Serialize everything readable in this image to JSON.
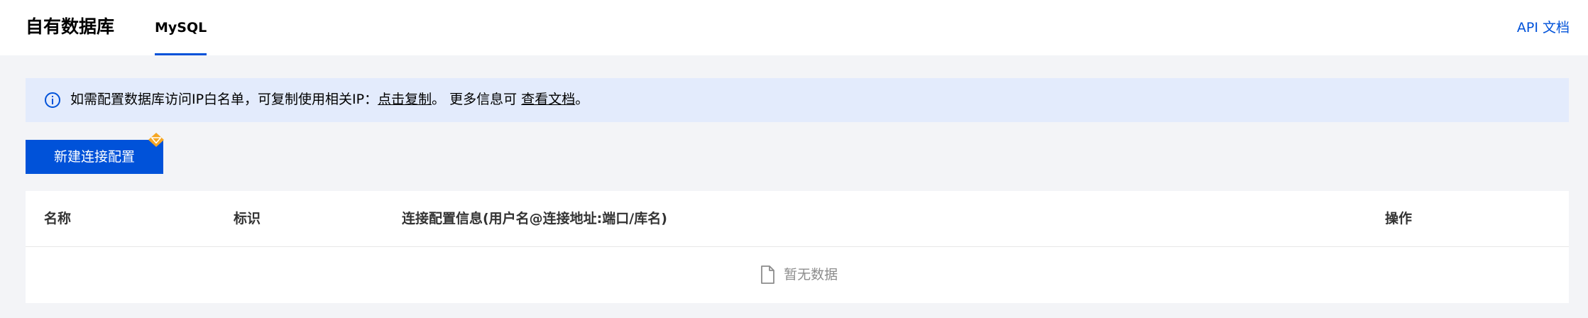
{
  "header": {
    "title": "自有数据库",
    "tab_label": "MySQL",
    "api_doc_label": "API 文档"
  },
  "notice": {
    "text_before": "如需配置数据库访问IP白名单，可复制使用相关IP：",
    "copy_link": "点击复制",
    "text_middle": "。 更多信息可 ",
    "doc_link": "查看文档",
    "text_after": "。"
  },
  "toolbar": {
    "create_label": "新建连接配置"
  },
  "table": {
    "columns": [
      "名称",
      "标识",
      "连接配置信息(用户名@连接地址:端口/库名)",
      "操作"
    ],
    "rows": [],
    "empty_text": "暂无数据"
  },
  "colors": {
    "brand": "#0052d9",
    "notice_bg": "#e3ebfc",
    "page_bg": "#f3f4f7",
    "badge": "#f5a623"
  }
}
